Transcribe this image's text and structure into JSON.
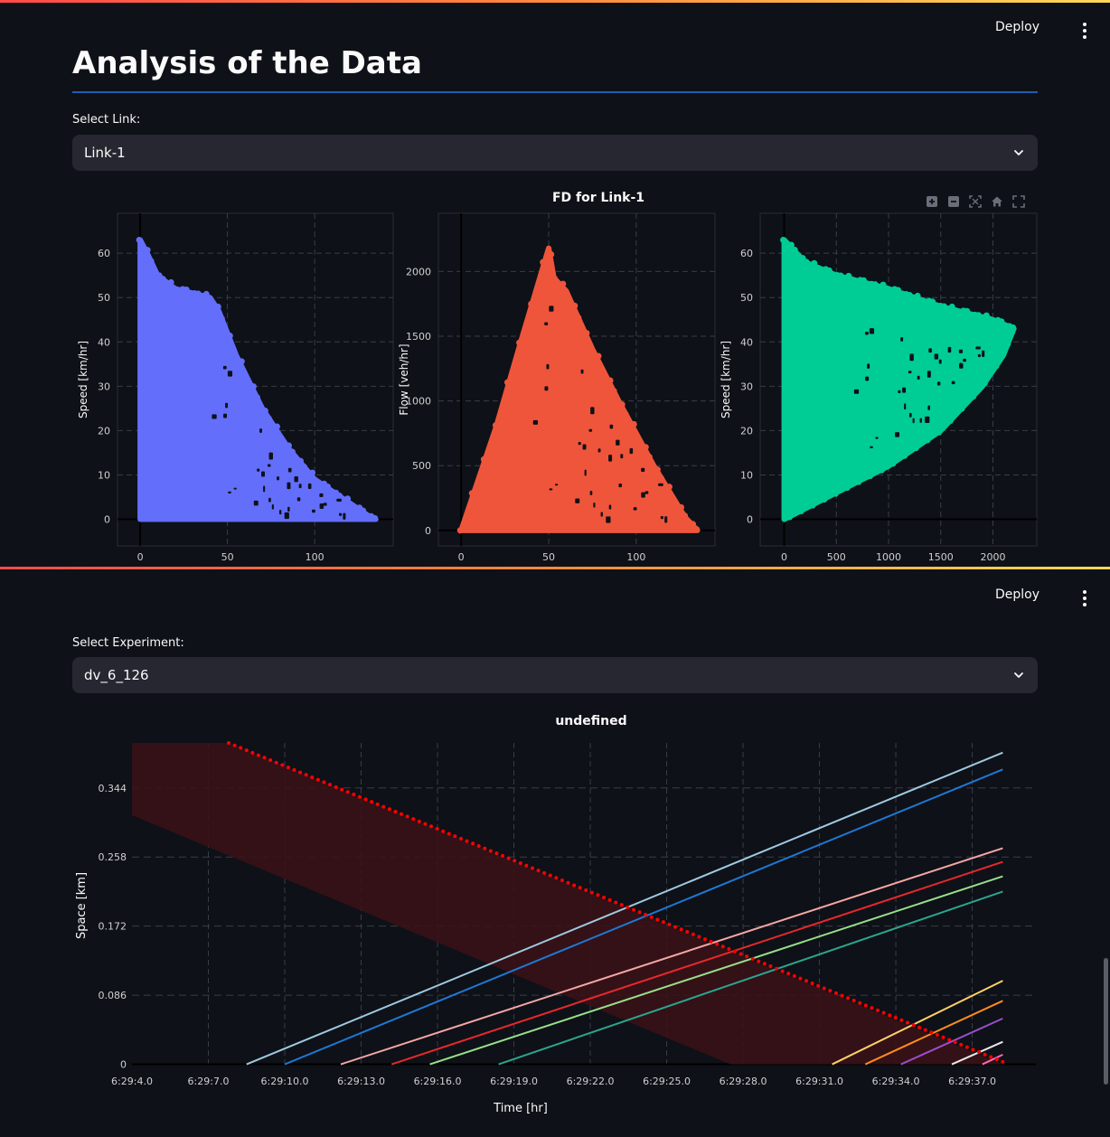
{
  "screen1": {
    "deploy_label": "Deploy",
    "page_title": "Analysis of the Data",
    "select_label": "Select Link:",
    "select_value": "Link-1",
    "chart_title": "FD for Link-1",
    "modebar_icons": [
      "zoom-in-icon",
      "zoom-out-icon",
      "autoscale-icon",
      "home-icon",
      "fullscreen-icon"
    ]
  },
  "screen2": {
    "deploy_label": "Deploy",
    "select_label": "Select Experiment:",
    "select_value": "dv_6_126",
    "chart_title": "undefined"
  },
  "colors": {
    "background": "#0e1117",
    "select_bg": "#262730",
    "title_rule": "#1c5fb0",
    "blue_series": "#636efa",
    "red_series": "#ef553b",
    "green_series": "#00cc96",
    "trajectory_red": "#ff0000"
  },
  "chart_data": [
    {
      "type": "scatter",
      "title": "",
      "xlabel": "",
      "ylabel": "Speed [km/hr]",
      "xlim": [
        -13,
        145
      ],
      "ylim": [
        -6,
        69
      ],
      "x_ticks": [
        0,
        50,
        100
      ],
      "y_ticks": [
        0,
        10,
        20,
        30,
        40,
        50,
        60
      ],
      "color": "#636efa",
      "envelope_upper": [
        [
          0,
          63
        ],
        [
          4,
          60
        ],
        [
          10,
          55
        ],
        [
          20,
          52
        ],
        [
          40,
          50
        ],
        [
          45,
          47
        ],
        [
          55,
          37
        ],
        [
          70,
          25
        ],
        [
          85,
          16
        ],
        [
          100,
          9
        ],
        [
          115,
          5
        ],
        [
          130,
          1
        ],
        [
          135,
          0
        ]
      ]
    },
    {
      "type": "scatter",
      "title": "",
      "xlabel": "",
      "ylabel": "Flow [veh/hr]",
      "xlim": [
        -13,
        145
      ],
      "ylim": [
        -120,
        2450
      ],
      "x_ticks": [
        0,
        50,
        100
      ],
      "y_ticks": [
        0,
        500,
        1000,
        1500,
        2000
      ],
      "color": "#ef553b",
      "envelope_upper": [
        [
          0,
          0
        ],
        [
          20,
          800
        ],
        [
          35,
          1500
        ],
        [
          50,
          2180
        ],
        [
          53,
          1950
        ],
        [
          60,
          1850
        ],
        [
          75,
          1400
        ],
        [
          90,
          1000
        ],
        [
          110,
          500
        ],
        [
          128,
          100
        ],
        [
          135,
          0
        ]
      ]
    },
    {
      "type": "scatter",
      "title": "",
      "xlabel": "",
      "ylabel": "Speed [km/hr]",
      "xlim": [
        -230,
        2420
      ],
      "ylim": [
        -6,
        69
      ],
      "x_ticks": [
        0,
        500,
        1000,
        1500,
        2000
      ],
      "y_ticks": [
        0,
        10,
        20,
        30,
        40,
        50,
        60
      ],
      "color": "#00cc96",
      "envelope_upper": [
        [
          0,
          63
        ],
        [
          200,
          58
        ],
        [
          500,
          55
        ],
        [
          1000,
          52
        ],
        [
          1500,
          48
        ],
        [
          2000,
          45
        ],
        [
          2200,
          43
        ]
      ],
      "envelope_lower": [
        [
          0,
          0
        ],
        [
          500,
          6
        ],
        [
          1000,
          12
        ],
        [
          1500,
          20
        ],
        [
          1900,
          30
        ],
        [
          2100,
          37
        ],
        [
          2200,
          43
        ]
      ]
    },
    {
      "type": "line",
      "title": "undefined",
      "xlabel": "Time [hr]",
      "ylabel": "Space [km]",
      "x_tick_labels": [
        "6:29:4.0",
        "6:29:7.0",
        "6:29:10.0",
        "6:29:13.0",
        "6:29:16.0",
        "6:29:19.0",
        "6:29:22.0",
        "6:29:25.0",
        "6:29:28.0",
        "6:29:31.0",
        "6:29:34.0",
        "6:29:37.0"
      ],
      "xlim": [
        4.0,
        39.5
      ],
      "ylim": [
        -0.005,
        0.4
      ],
      "y_ticks": [
        0,
        0.086,
        0.172,
        0.258,
        0.344
      ],
      "y_tick_labels": [
        "0",
        "0.086",
        "0.172",
        "0.258",
        "0.344"
      ],
      "shaded_band": {
        "color": "#3a1216",
        "points": [
          [
            4.0,
            0.4
          ],
          [
            7.8,
            0.4
          ],
          [
            38.2,
            0.0
          ],
          [
            27.5,
            0.0
          ],
          [
            4.0,
            0.31
          ]
        ]
      },
      "red_dotted": {
        "color": "#ff0000",
        "start": [
          7.8,
          0.4
        ],
        "end": [
          38.2,
          0.003
        ]
      },
      "series": [
        {
          "color": "#9ecae1",
          "start": [
            8.5,
            0.0
          ],
          "end": [
            38.2,
            0.388
          ]
        },
        {
          "color": "#1f77d4",
          "start": [
            10.0,
            0.0
          ],
          "end": [
            38.2,
            0.367
          ]
        },
        {
          "color": "#f4a6a6",
          "start": [
            12.2,
            0.0
          ],
          "end": [
            38.2,
            0.269
          ]
        },
        {
          "color": "#e8282c",
          "start": [
            14.2,
            0.0
          ],
          "end": [
            38.2,
            0.252
          ]
        },
        {
          "color": "#98df8a",
          "start": [
            15.7,
            0.0
          ],
          "end": [
            38.2,
            0.234
          ]
        },
        {
          "color": "#2ca58d",
          "start": [
            18.4,
            0.0
          ],
          "end": [
            38.2,
            0.215
          ]
        },
        {
          "color": "#ffd166",
          "start": [
            31.5,
            0.0
          ],
          "end": [
            38.2,
            0.104
          ]
        },
        {
          "color": "#ff8c1a",
          "start": [
            32.8,
            0.0
          ],
          "end": [
            38.2,
            0.079
          ]
        },
        {
          "color": "#9b4dca",
          "start": [
            34.2,
            0.0
          ],
          "end": [
            38.2,
            0.057
          ]
        },
        {
          "color": "#e8e8e8",
          "start": [
            36.2,
            0.0
          ],
          "end": [
            38.2,
            0.028
          ]
        },
        {
          "color": "#ff69b4",
          "start": [
            37.4,
            0.0
          ],
          "end": [
            38.2,
            0.012
          ]
        }
      ]
    }
  ]
}
